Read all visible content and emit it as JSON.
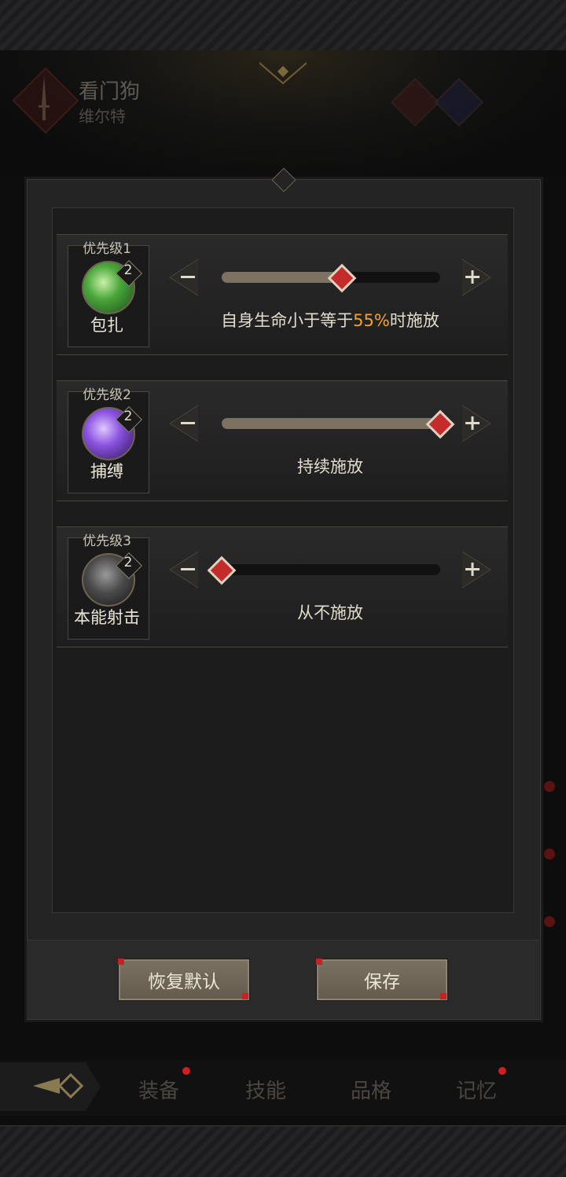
{
  "header": {
    "character_name": "看门狗",
    "character_subtitle": "维尔特"
  },
  "dialog": {
    "rows": [
      {
        "priority": "优先级1",
        "skill_name": "包扎",
        "skill_level": "2",
        "minus": "−",
        "plus": "+",
        "slider_fraction": 0.55,
        "condition_prefix": "自身生命小于等于",
        "condition_highlight": "55%",
        "condition_suffix": "时施放"
      },
      {
        "priority": "优先级2",
        "skill_name": "捕缚",
        "skill_level": "2",
        "minus": "−",
        "plus": "+",
        "slider_fraction": 1.0,
        "condition_prefix": "持续施放",
        "condition_highlight": "",
        "condition_suffix": ""
      },
      {
        "priority": "优先级3",
        "skill_name": "本能射击",
        "skill_level": "2",
        "minus": "−",
        "plus": "+",
        "slider_fraction": 0.0,
        "condition_prefix": "从不施放",
        "condition_highlight": "",
        "condition_suffix": ""
      }
    ],
    "reset_button": "恢复默认",
    "save_button": "保存"
  },
  "nav": {
    "tabs": [
      {
        "label": "装备",
        "has_dot": true
      },
      {
        "label": "技能",
        "has_dot": false
      },
      {
        "label": "品格",
        "has_dot": false
      },
      {
        "label": "记忆",
        "has_dot": true
      }
    ]
  },
  "colors": {
    "highlight": "#f2a133",
    "slider_thumb": "#c42b2b",
    "notification_dot": "#d11e1e"
  }
}
